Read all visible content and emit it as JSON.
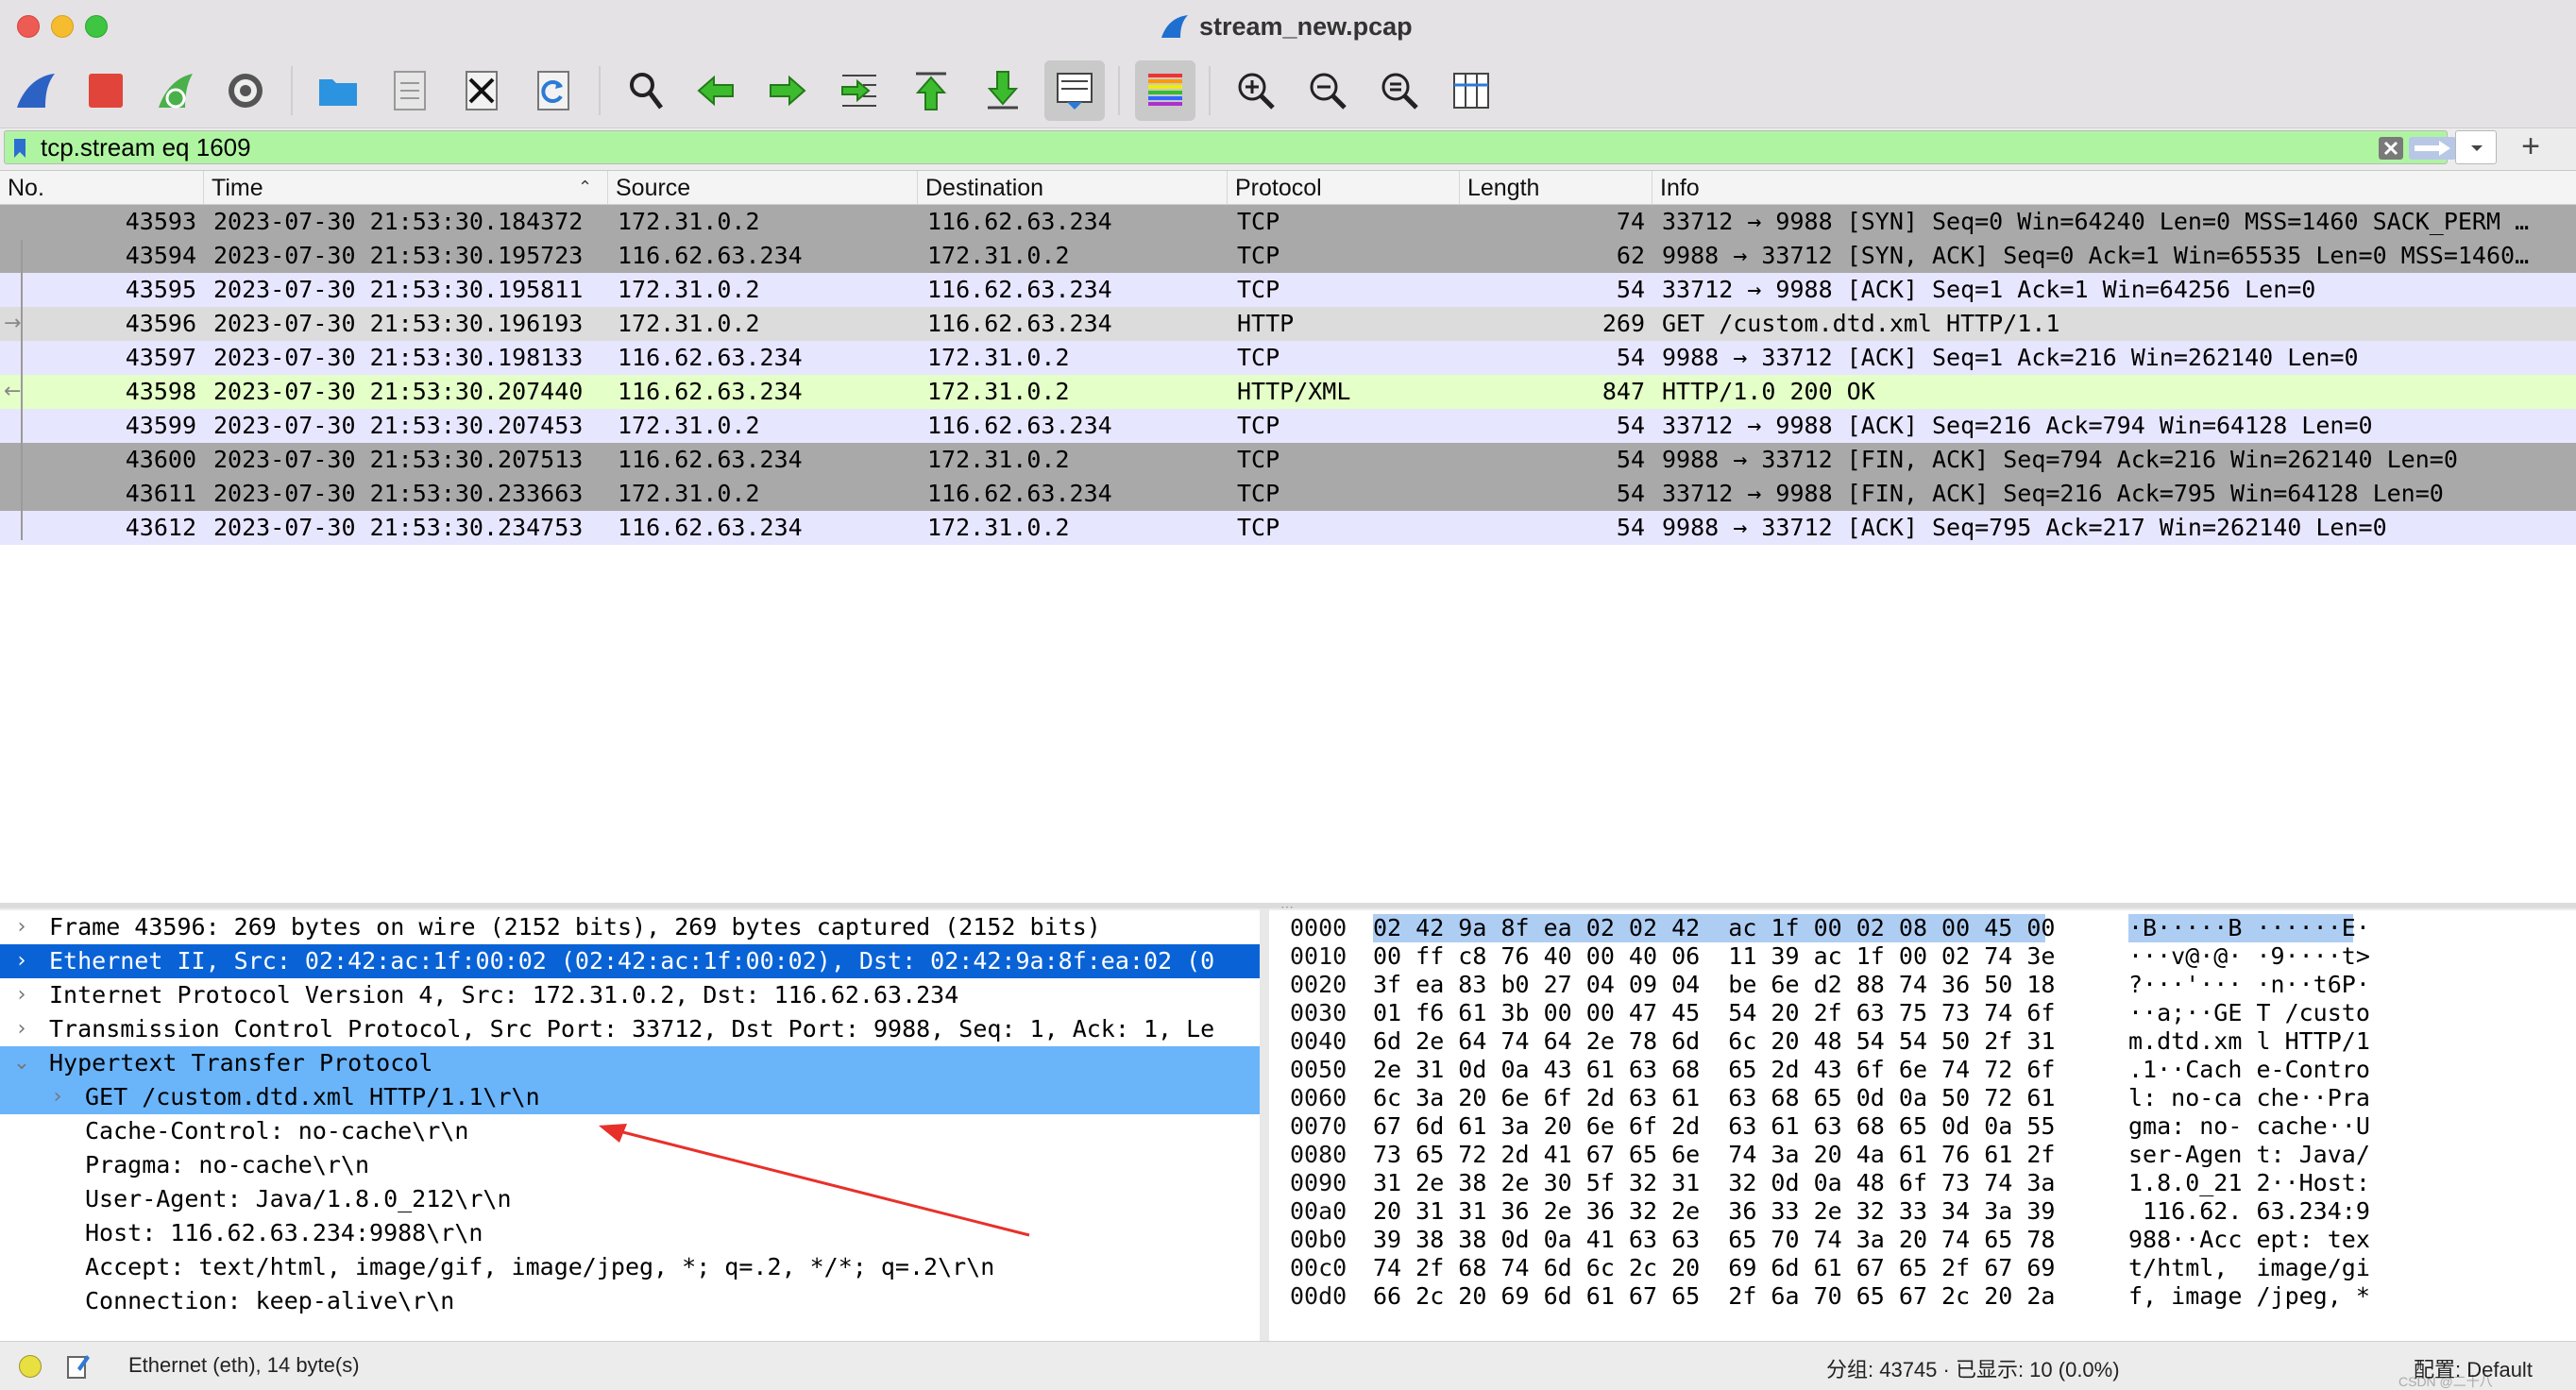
{
  "window": {
    "title": "stream_new.pcap"
  },
  "toolbar": {
    "buttons": [
      "start-capture-icon",
      "stop-capture-icon",
      "restart-capture-icon",
      "capture-options-icon",
      "open-file-icon",
      "save-file-icon",
      "close-file-icon",
      "reload-file-icon",
      "find-packet-icon",
      "go-back-icon",
      "go-forward-icon",
      "go-to-packet-icon",
      "go-first-packet-icon",
      "go-last-packet-icon",
      "autoscroll-icon",
      "colorize-icon",
      "zoom-in-icon",
      "zoom-out-icon",
      "normal-size-icon",
      "resize-columns-icon"
    ]
  },
  "filter": {
    "value": "tcp.stream eq 1609",
    "add_label": "+"
  },
  "columns": [
    "No.",
    "Time",
    "Source",
    "Destination",
    "Protocol",
    "Length",
    "Info"
  ],
  "sort_indicator": "⌃",
  "packets": [
    {
      "no": "43593",
      "time": "2023-07-30 21:53:30.184372",
      "src": "172.31.0.2",
      "dst": "116.62.63.234",
      "proto": "TCP",
      "len": "74",
      "info": "33712 → 9988 [SYN] Seq=0 Win=64240 Len=0 MSS=1460 SACK_PERM …",
      "rel": "",
      "bg": "#a9a9a9"
    },
    {
      "no": "43594",
      "time": "2023-07-30 21:53:30.195723",
      "src": "116.62.63.234",
      "dst": "172.31.0.2",
      "proto": "TCP",
      "len": "62",
      "info": "9988 → 33712 [SYN, ACK] Seq=0 Ack=1 Win=65535 Len=0 MSS=1460…",
      "rel": "",
      "bg": "#a9a9a9"
    },
    {
      "no": "43595",
      "time": "2023-07-30 21:53:30.195811",
      "src": "172.31.0.2",
      "dst": "116.62.63.234",
      "proto": "TCP",
      "len": "54",
      "info": "33712 → 9988 [ACK] Seq=1 Ack=1 Win=64256 Len=0",
      "rel": "",
      "bg": "#e7e6ff"
    },
    {
      "no": "43596",
      "time": "2023-07-30 21:53:30.196193",
      "src": "172.31.0.2",
      "dst": "116.62.63.234",
      "proto": "HTTP",
      "len": "269",
      "info": "GET /custom.dtd.xml HTTP/1.1",
      "rel": "→",
      "bg": "#dcdcdc"
    },
    {
      "no": "43597",
      "time": "2023-07-30 21:53:30.198133",
      "src": "116.62.63.234",
      "dst": "172.31.0.2",
      "proto": "TCP",
      "len": "54",
      "info": "9988 → 33712 [ACK] Seq=1 Ack=216 Win=262140 Len=0",
      "rel": "",
      "bg": "#e7e6ff"
    },
    {
      "no": "43598",
      "time": "2023-07-30 21:53:30.207440",
      "src": "116.62.63.234",
      "dst": "172.31.0.2",
      "proto": "HTTP/XML",
      "len": "847",
      "info": "HTTP/1.0 200 OK",
      "rel": "←",
      "bg": "#e4ffc7"
    },
    {
      "no": "43599",
      "time": "2023-07-30 21:53:30.207453",
      "src": "172.31.0.2",
      "dst": "116.62.63.234",
      "proto": "TCP",
      "len": "54",
      "info": "33712 → 9988 [ACK] Seq=216 Ack=794 Win=64128 Len=0",
      "rel": "",
      "bg": "#e7e6ff"
    },
    {
      "no": "43600",
      "time": "2023-07-30 21:53:30.207513",
      "src": "116.62.63.234",
      "dst": "172.31.0.2",
      "proto": "TCP",
      "len": "54",
      "info": "9988 → 33712 [FIN, ACK] Seq=794 Ack=216 Win=262140 Len=0",
      "rel": "",
      "bg": "#a9a9a9"
    },
    {
      "no": "43611",
      "time": "2023-07-30 21:53:30.233663",
      "src": "172.31.0.2",
      "dst": "116.62.63.234",
      "proto": "TCP",
      "len": "54",
      "info": "33712 → 9988 [FIN, ACK] Seq=216 Ack=795 Win=64128 Len=0",
      "rel": "",
      "bg": "#a9a9a9"
    },
    {
      "no": "43612",
      "time": "2023-07-30 21:53:30.234753",
      "src": "116.62.63.234",
      "dst": "172.31.0.2",
      "proto": "TCP",
      "len": "54",
      "info": "9988 → 33712 [ACK] Seq=795 Ack=217 Win=262140 Len=0",
      "rel": "",
      "bg": "#e7e6ff"
    }
  ],
  "details": [
    {
      "arrow": "›",
      "text": "Frame 43596: 269 bytes on wire (2152 bits), 269 bytes captured (2152 bits)",
      "level": 0,
      "state": ""
    },
    {
      "arrow": "›",
      "text": "Ethernet II, Src: 02:42:ac:1f:00:02 (02:42:ac:1f:00:02), Dst: 02:42:9a:8f:ea:02 (0",
      "level": 0,
      "state": "sel-dark"
    },
    {
      "arrow": "›",
      "text": "Internet Protocol Version 4, Src: 172.31.0.2, Dst: 116.62.63.234",
      "level": 0,
      "state": ""
    },
    {
      "arrow": "›",
      "text": "Transmission Control Protocol, Src Port: 33712, Dst Port: 9988, Seq: 1, Ack: 1, Le",
      "level": 0,
      "state": ""
    },
    {
      "arrow": "⌄",
      "text": "Hypertext Transfer Protocol",
      "level": 0,
      "state": "sel-light"
    },
    {
      "arrow": "›",
      "text": "GET /custom.dtd.xml HTTP/1.1\\r\\n",
      "level": 1,
      "state": "sel-light"
    },
    {
      "arrow": "",
      "text": "Cache-Control: no-cache\\r\\n",
      "level": 1,
      "state": ""
    },
    {
      "arrow": "",
      "text": "Pragma: no-cache\\r\\n",
      "level": 1,
      "state": ""
    },
    {
      "arrow": "",
      "text": "User-Agent: Java/1.8.0_212\\r\\n",
      "level": 1,
      "state": ""
    },
    {
      "arrow": "",
      "text": "Host: 116.62.63.234:9988\\r\\n",
      "level": 1,
      "state": ""
    },
    {
      "arrow": "",
      "text": "Accept: text/html, image/gif, image/jpeg, *; q=.2, */*; q=.2\\r\\n",
      "level": 1,
      "state": ""
    },
    {
      "arrow": "",
      "text": "Connection: keep-alive\\r\\n",
      "level": 1,
      "state": ""
    }
  ],
  "bytes": [
    {
      "off": "0000",
      "hex": "02 42 9a 8f ea 02 02 42  ac 1f 00 02 08 00 45 00",
      "ascii": "·B·····B ······E·",
      "hl": true
    },
    {
      "off": "0010",
      "hex": "00 ff c8 76 40 00 40 06  11 39 ac 1f 00 02 74 3e",
      "ascii": "···v@·@· ·9····t>",
      "hl": false
    },
    {
      "off": "0020",
      "hex": "3f ea 83 b0 27 04 09 04  be 6e d2 88 74 36 50 18",
      "ascii": "?···'··· ·n··t6P·",
      "hl": false
    },
    {
      "off": "0030",
      "hex": "01 f6 61 3b 00 00 47 45  54 20 2f 63 75 73 74 6f",
      "ascii": "··a;··GE T /custo",
      "hl": false
    },
    {
      "off": "0040",
      "hex": "6d 2e 64 74 64 2e 78 6d  6c 20 48 54 54 50 2f 31",
      "ascii": "m.dtd.xm l HTTP/1",
      "hl": false
    },
    {
      "off": "0050",
      "hex": "2e 31 0d 0a 43 61 63 68  65 2d 43 6f 6e 74 72 6f",
      "ascii": ".1··Cach e-Contro",
      "hl": false
    },
    {
      "off": "0060",
      "hex": "6c 3a 20 6e 6f 2d 63 61  63 68 65 0d 0a 50 72 61",
      "ascii": "l: no-ca che··Pra",
      "hl": false
    },
    {
      "off": "0070",
      "hex": "67 6d 61 3a 20 6e 6f 2d  63 61 63 68 65 0d 0a 55",
      "ascii": "gma: no- cache··U",
      "hl": false
    },
    {
      "off": "0080",
      "hex": "73 65 72 2d 41 67 65 6e  74 3a 20 4a 61 76 61 2f",
      "ascii": "ser-Agen t: Java/",
      "hl": false
    },
    {
      "off": "0090",
      "hex": "31 2e 38 2e 30 5f 32 31  32 0d 0a 48 6f 73 74 3a",
      "ascii": "1.8.0_21 2··Host:",
      "hl": false
    },
    {
      "off": "00a0",
      "hex": "20 31 31 36 2e 36 32 2e  36 33 2e 32 33 34 3a 39",
      "ascii": " 116.62. 63.234:9",
      "hl": false
    },
    {
      "off": "00b0",
      "hex": "39 38 38 0d 0a 41 63 63  65 70 74 3a 20 74 65 78",
      "ascii": "988··Acc ept: tex",
      "hl": false
    },
    {
      "off": "00c0",
      "hex": "74 2f 68 74 6d 6c 2c 20  69 6d 61 67 65 2f 67 69",
      "ascii": "t/html,  image/gi",
      "hl": false
    },
    {
      "off": "00d0",
      "hex": "66 2c 20 69 6d 61 67 65  2f 6a 70 65 67 2c 20 2a",
      "ascii": "f, image /jpeg, *",
      "hl": false
    }
  ],
  "status": {
    "text": "Ethernet (eth), 14 byte(s)",
    "packets": "分组: 43745 · 已显示: 10 (0.0%)",
    "profile": "配置: Default",
    "mark": "CSDN @二十八"
  },
  "colors": {
    "accent": "#0a63d6",
    "filter_bg": "#aff5a1",
    "selected_light": "#6ab4fa",
    "annotation_arrow": "#e8302a"
  }
}
